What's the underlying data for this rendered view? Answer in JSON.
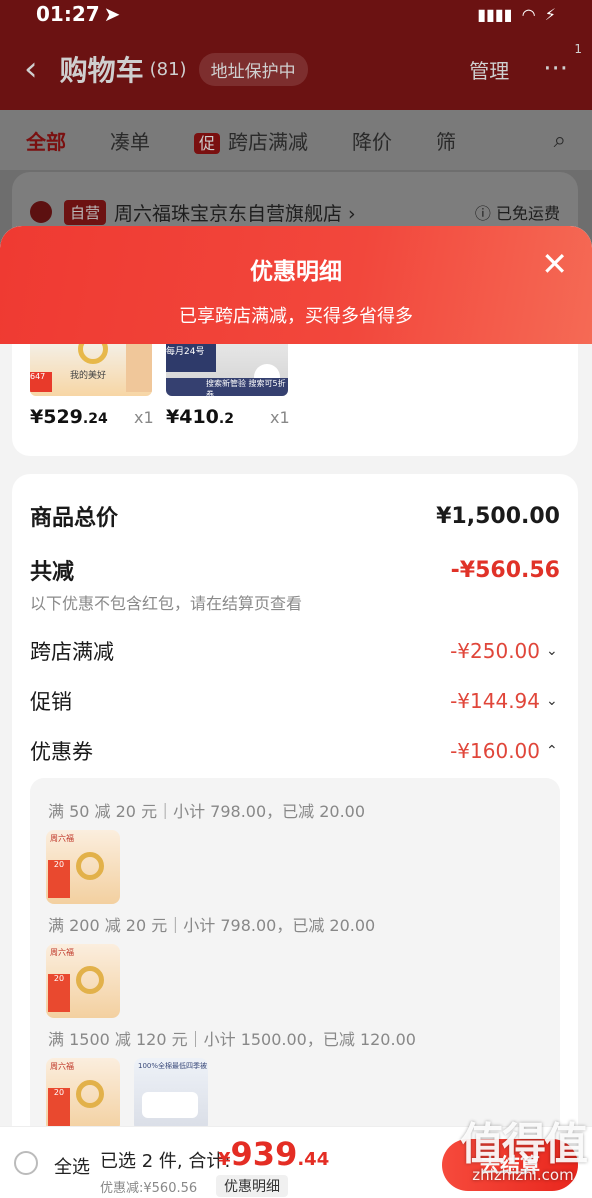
{
  "status_bar": {
    "time": "01:27",
    "battery": "⚡"
  },
  "nav": {
    "back": "‹",
    "title": "购物车",
    "count": "(81)",
    "address": "地址保护中",
    "manage": "管理",
    "more": "···",
    "badge": "1"
  },
  "tabs": [
    {
      "label": "全部"
    },
    {
      "label": "凑单"
    },
    {
      "tag": "促",
      "label": "跨店满减"
    },
    {
      "label": "降价"
    },
    {
      "label": "筛"
    }
  ],
  "store": {
    "ziying": "自营",
    "name": "周六福珠宝京东自营旗舰店 ›",
    "freeship": "ⓘ 已免运费"
  },
  "sheet": {
    "title": "优惠明细",
    "subtitle": "已享跨店满减，买得多省得多",
    "close": "✕",
    "products": [
      {
        "price_int": "¥529",
        "price_dec": ".24",
        "qty": "x1",
        "thumb_text": "我的美好",
        "thumb_badge": "647"
      },
      {
        "price_int": "¥410",
        "price_dec": ".2",
        "qty": "x1",
        "thumb_text": "每月24号",
        "thumb_strip": "搜索新管验 搜索可5折券"
      }
    ],
    "summary": {
      "total_label": "商品总价",
      "total_value": "¥1,500.00",
      "reduce_label": "共减",
      "reduce_value": "-¥560.56",
      "note": "以下优惠不包含红包，请在结算页查看",
      "items": [
        {
          "label": "跨店满减",
          "value": "-¥250.00",
          "chevron": "⌄"
        },
        {
          "label": "促销",
          "value": "-¥144.94",
          "chevron": "⌄"
        },
        {
          "label": "优惠券",
          "value": "-¥160.00",
          "chevron": "⌃"
        }
      ],
      "coupons": [
        {
          "line": "满 50 减 20 元｜小计 798.00，已减 20.00"
        },
        {
          "line": "满 200 减 20 元｜小计 798.00，已减 20.00"
        },
        {
          "line": "满 1500 减 120 元｜小计 1500.00，已减 120.00"
        }
      ],
      "thumb_brand": "周六福",
      "thumb_tag": "20",
      "thumb2_header": "100%全棉最低四季被"
    }
  },
  "bottom": {
    "select_all": "全选",
    "summary": "已选 2 件, 合计:",
    "total_currency": "¥",
    "total_int": "939",
    "total_dec": ".44",
    "reduced": "优惠减:¥560.56",
    "detail": "优惠明细",
    "checkout": "去结算"
  },
  "watermark": {
    "line1": "值得值",
    "line2": "zhizhizhi.com"
  }
}
